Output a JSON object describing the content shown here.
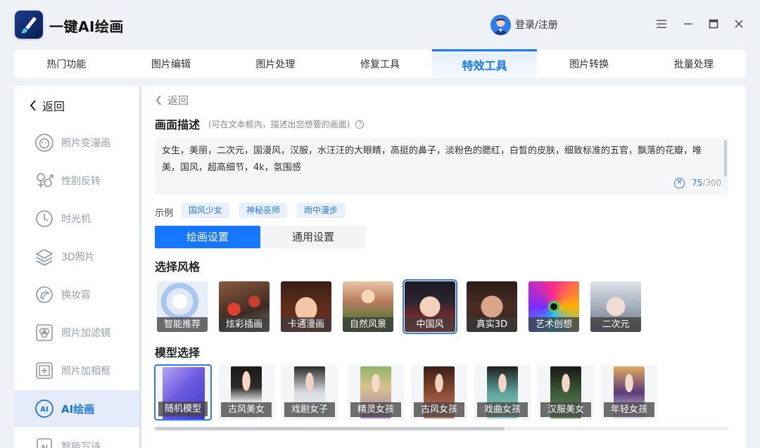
{
  "app": {
    "title": "一键AI绘画",
    "login_label": "登录/注册"
  },
  "colors": {
    "accent": "#1677ff",
    "active_bg": "#e4ecfb"
  },
  "top_tabs": [
    {
      "label": "热门功能"
    },
    {
      "label": "图片编辑"
    },
    {
      "label": "图片处理"
    },
    {
      "label": "修复工具"
    },
    {
      "label": "特效工具",
      "active": true
    },
    {
      "label": "图片转换"
    },
    {
      "label": "批量处理"
    }
  ],
  "sidebar": {
    "back_label": "返回",
    "items": [
      {
        "label": "照片变漫画",
        "icon": "face-icon"
      },
      {
        "label": "性别反转",
        "icon": "gender-icon"
      },
      {
        "label": "时光机",
        "icon": "clock-icon"
      },
      {
        "label": "3D照片",
        "icon": "layers-icon"
      },
      {
        "label": "换妆容",
        "icon": "makeup-icon"
      },
      {
        "label": "照片加滤镜",
        "icon": "filter-icon"
      },
      {
        "label": "照片加相框",
        "icon": "frame-icon"
      },
      {
        "label": "AI绘画",
        "icon": "ai-paint-icon",
        "active": true
      },
      {
        "label": "智能写诗",
        "icon": "ai-poem-icon"
      }
    ]
  },
  "main": {
    "back_label": "返回",
    "prompt": {
      "title": "画面描述",
      "hint": "(可在文本框内，描述出您想要的画面)",
      "help_glyph": "?",
      "text": "女生，美丽，二次元，国漫风，汉服，水汪汪的大眼睛，高挺的鼻子，淡粉色的腮红，白皙的皮肤，细致标准的五官，飘落的花瓣，唯美，国风，超高细节，4k，氛围感",
      "clear_glyph": "✕",
      "count": "75",
      "max": "/300"
    },
    "examples_label": "示例",
    "examples": [
      "国风少女",
      "神秘巫师",
      "雨中漫步"
    ],
    "settings_tabs": [
      {
        "label": "绘画设置",
        "active": true
      },
      {
        "label": "通用设置"
      }
    ],
    "style_title": "选择风格",
    "styles": [
      {
        "label": "智能推荐"
      },
      {
        "label": "炫彩插画"
      },
      {
        "label": "卡通漫画"
      },
      {
        "label": "自然风景"
      },
      {
        "label": "中国风",
        "selected": true
      },
      {
        "label": "真实3D"
      },
      {
        "label": "艺术创想"
      },
      {
        "label": "二次元"
      }
    ],
    "model_title": "模型选择",
    "models": [
      {
        "label": "随机模型",
        "selected": true
      },
      {
        "label": "古风美女"
      },
      {
        "label": "戏剧女子"
      },
      {
        "label": "精灵女孩"
      },
      {
        "label": "古风女孩"
      },
      {
        "label": "戏曲女孩"
      },
      {
        "label": "汉服美女"
      },
      {
        "label": "年轻女孩"
      }
    ],
    "h_scroll_fraction": 0.61
  }
}
